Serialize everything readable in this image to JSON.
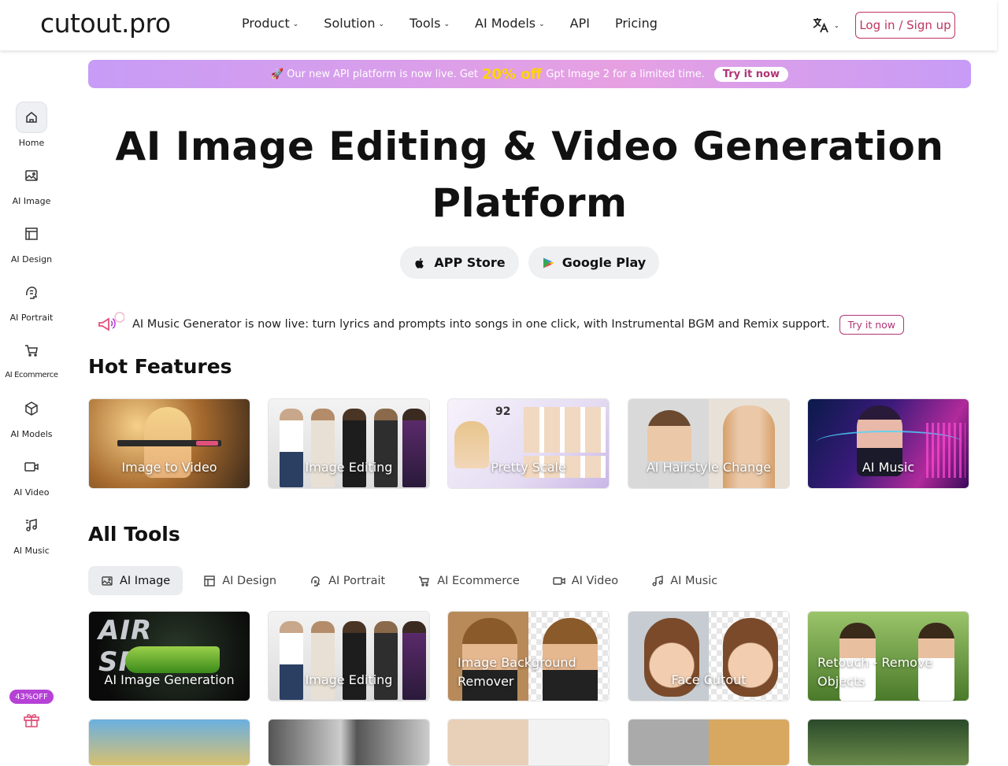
{
  "header": {
    "logo": "cutout.pro",
    "nav": [
      "Product",
      "Solution",
      "Tools",
      "AI Models",
      "API",
      "Pricing"
    ],
    "login_label": "Log in / Sign up"
  },
  "sidebar": {
    "items": [
      {
        "label": "Home",
        "icon": "home-icon"
      },
      {
        "label": "AI Image",
        "icon": "image-icon"
      },
      {
        "label": "AI Design",
        "icon": "design-icon"
      },
      {
        "label": "AI Portrait",
        "icon": "portrait-icon"
      },
      {
        "label": "AI Ecommerce",
        "icon": "cart-icon"
      },
      {
        "label": "AI Models",
        "icon": "cube-icon"
      },
      {
        "label": "AI Video",
        "icon": "video-icon"
      },
      {
        "label": "AI Music",
        "icon": "music-icon"
      }
    ],
    "promo_badge": "43%OFF"
  },
  "banner": {
    "emoji": "🚀",
    "text_before": "Our new API platform is now live. Get",
    "highlight": "20% off",
    "text_after": "Gpt Image 2 for a limited time.",
    "cta": "Try it now"
  },
  "hero": {
    "title": "AI Image Editing & Video Generation Platform",
    "app_store": "APP Store",
    "google_play": "Google Play"
  },
  "notice": {
    "text": "AI Music Generator is now live: turn lyrics and prompts into songs in one click, with Instrumental BGM and Remix support.",
    "cta": "Try it now"
  },
  "hot_features": {
    "heading": "Hot Features",
    "items": [
      "Image to Video",
      "Image Editing",
      "Pretty Scale",
      "AI Hairstyle Change",
      "AI Music"
    ]
  },
  "all_tools": {
    "heading": "All Tools",
    "tabs": [
      "AI Image",
      "AI Design",
      "AI Portrait",
      "AI Ecommerce",
      "AI Video",
      "AI Music"
    ],
    "cards": [
      "AI Image Generation",
      "Image Editing",
      "Image Background Remover",
      "Face Cutout",
      "Retouch - Remove Objects"
    ]
  },
  "colors": {
    "accent": "#c0345f",
    "banner": "#c79cf6",
    "highlight": "#ffd400"
  }
}
